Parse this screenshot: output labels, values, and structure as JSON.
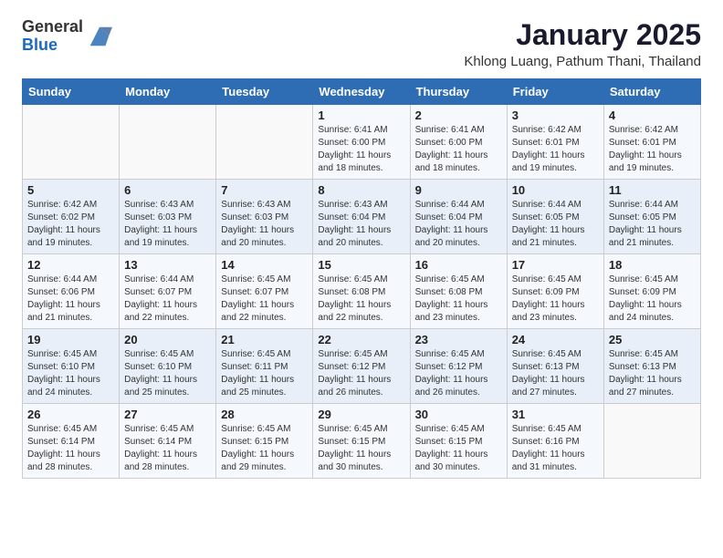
{
  "header": {
    "logo_general": "General",
    "logo_blue": "Blue",
    "month_title": "January 2025",
    "location": "Khlong Luang, Pathum Thani, Thailand"
  },
  "days_of_week": [
    "Sunday",
    "Monday",
    "Tuesday",
    "Wednesday",
    "Thursday",
    "Friday",
    "Saturday"
  ],
  "weeks": [
    [
      {
        "day": "",
        "info": ""
      },
      {
        "day": "",
        "info": ""
      },
      {
        "day": "",
        "info": ""
      },
      {
        "day": "1",
        "info": "Sunrise: 6:41 AM\nSunset: 6:00 PM\nDaylight: 11 hours and 18 minutes."
      },
      {
        "day": "2",
        "info": "Sunrise: 6:41 AM\nSunset: 6:00 PM\nDaylight: 11 hours and 18 minutes."
      },
      {
        "day": "3",
        "info": "Sunrise: 6:42 AM\nSunset: 6:01 PM\nDaylight: 11 hours and 19 minutes."
      },
      {
        "day": "4",
        "info": "Sunrise: 6:42 AM\nSunset: 6:01 PM\nDaylight: 11 hours and 19 minutes."
      }
    ],
    [
      {
        "day": "5",
        "info": "Sunrise: 6:42 AM\nSunset: 6:02 PM\nDaylight: 11 hours and 19 minutes."
      },
      {
        "day": "6",
        "info": "Sunrise: 6:43 AM\nSunset: 6:03 PM\nDaylight: 11 hours and 19 minutes."
      },
      {
        "day": "7",
        "info": "Sunrise: 6:43 AM\nSunset: 6:03 PM\nDaylight: 11 hours and 20 minutes."
      },
      {
        "day": "8",
        "info": "Sunrise: 6:43 AM\nSunset: 6:04 PM\nDaylight: 11 hours and 20 minutes."
      },
      {
        "day": "9",
        "info": "Sunrise: 6:44 AM\nSunset: 6:04 PM\nDaylight: 11 hours and 20 minutes."
      },
      {
        "day": "10",
        "info": "Sunrise: 6:44 AM\nSunset: 6:05 PM\nDaylight: 11 hours and 21 minutes."
      },
      {
        "day": "11",
        "info": "Sunrise: 6:44 AM\nSunset: 6:05 PM\nDaylight: 11 hours and 21 minutes."
      }
    ],
    [
      {
        "day": "12",
        "info": "Sunrise: 6:44 AM\nSunset: 6:06 PM\nDaylight: 11 hours and 21 minutes."
      },
      {
        "day": "13",
        "info": "Sunrise: 6:44 AM\nSunset: 6:07 PM\nDaylight: 11 hours and 22 minutes."
      },
      {
        "day": "14",
        "info": "Sunrise: 6:45 AM\nSunset: 6:07 PM\nDaylight: 11 hours and 22 minutes."
      },
      {
        "day": "15",
        "info": "Sunrise: 6:45 AM\nSunset: 6:08 PM\nDaylight: 11 hours and 22 minutes."
      },
      {
        "day": "16",
        "info": "Sunrise: 6:45 AM\nSunset: 6:08 PM\nDaylight: 11 hours and 23 minutes."
      },
      {
        "day": "17",
        "info": "Sunrise: 6:45 AM\nSunset: 6:09 PM\nDaylight: 11 hours and 23 minutes."
      },
      {
        "day": "18",
        "info": "Sunrise: 6:45 AM\nSunset: 6:09 PM\nDaylight: 11 hours and 24 minutes."
      }
    ],
    [
      {
        "day": "19",
        "info": "Sunrise: 6:45 AM\nSunset: 6:10 PM\nDaylight: 11 hours and 24 minutes."
      },
      {
        "day": "20",
        "info": "Sunrise: 6:45 AM\nSunset: 6:10 PM\nDaylight: 11 hours and 25 minutes."
      },
      {
        "day": "21",
        "info": "Sunrise: 6:45 AM\nSunset: 6:11 PM\nDaylight: 11 hours and 25 minutes."
      },
      {
        "day": "22",
        "info": "Sunrise: 6:45 AM\nSunset: 6:12 PM\nDaylight: 11 hours and 26 minutes."
      },
      {
        "day": "23",
        "info": "Sunrise: 6:45 AM\nSunset: 6:12 PM\nDaylight: 11 hours and 26 minutes."
      },
      {
        "day": "24",
        "info": "Sunrise: 6:45 AM\nSunset: 6:13 PM\nDaylight: 11 hours and 27 minutes."
      },
      {
        "day": "25",
        "info": "Sunrise: 6:45 AM\nSunset: 6:13 PM\nDaylight: 11 hours and 27 minutes."
      }
    ],
    [
      {
        "day": "26",
        "info": "Sunrise: 6:45 AM\nSunset: 6:14 PM\nDaylight: 11 hours and 28 minutes."
      },
      {
        "day": "27",
        "info": "Sunrise: 6:45 AM\nSunset: 6:14 PM\nDaylight: 11 hours and 28 minutes."
      },
      {
        "day": "28",
        "info": "Sunrise: 6:45 AM\nSunset: 6:15 PM\nDaylight: 11 hours and 29 minutes."
      },
      {
        "day": "29",
        "info": "Sunrise: 6:45 AM\nSunset: 6:15 PM\nDaylight: 11 hours and 30 minutes."
      },
      {
        "day": "30",
        "info": "Sunrise: 6:45 AM\nSunset: 6:15 PM\nDaylight: 11 hours and 30 minutes."
      },
      {
        "day": "31",
        "info": "Sunrise: 6:45 AM\nSunset: 6:16 PM\nDaylight: 11 hours and 31 minutes."
      },
      {
        "day": "",
        "info": ""
      }
    ]
  ]
}
